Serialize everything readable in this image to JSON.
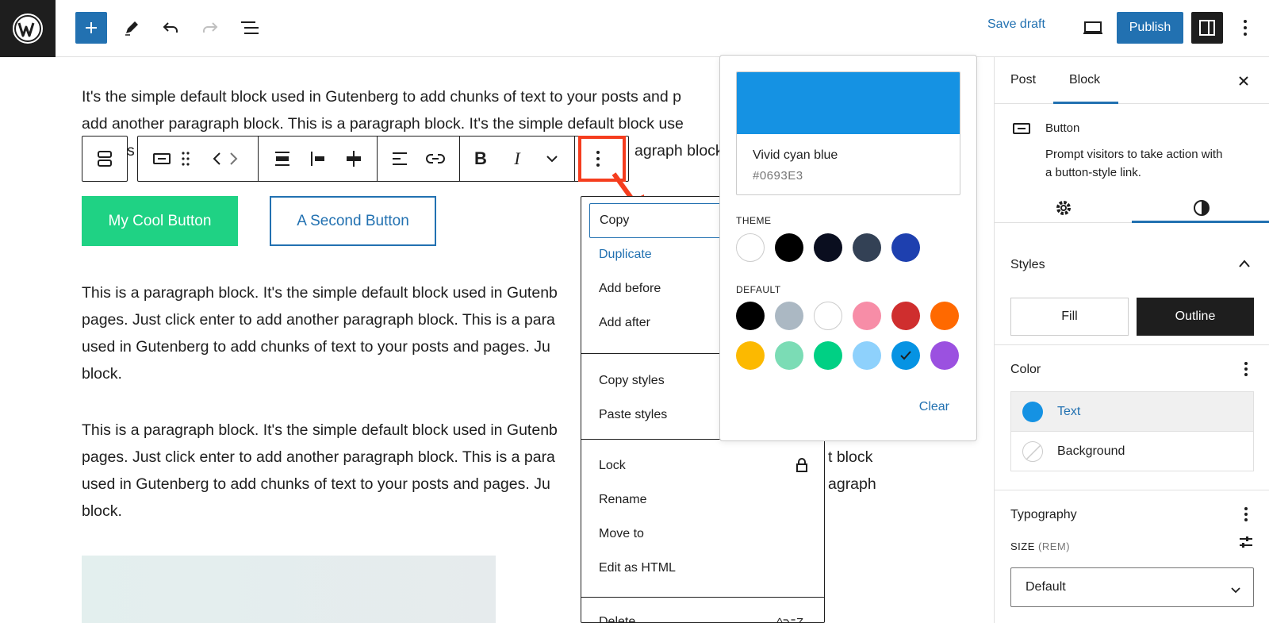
{
  "header": {
    "save_draft": "Save draft",
    "publish": "Publish"
  },
  "content": {
    "para1_line1": "It's the simple default block used in Gutenberg to add chunks of text to your posts and p",
    "para1_line2": "add another paragraph block. This is a paragraph block. It's the simple default block use",
    "para1_line3_fragment_a": "s",
    "para1_line3_fragment_b": "agraph block.",
    "button1_label": "My Cool Button",
    "button2_label": "A Second Button",
    "para2_lines": [
      "This is a paragraph block. It's the simple default block used in Gutenb",
      "pages. Just click enter to add another paragraph block. This is a para",
      "used in Gutenberg to add chunks of text to your posts and pages. Ju",
      "block."
    ],
    "para3_lines": [
      "This is a paragraph block. It's the simple default block used in Gutenb",
      "pages. Just click enter to add another paragraph block. This is a para",
      "used in Gutenberg to add chunks of text to your posts and pages. Ju",
      "block."
    ],
    "para3_right": {
      "line2": "t block",
      "line3": "agraph"
    }
  },
  "menu": {
    "items": [
      {
        "label": "Copy"
      },
      {
        "label": "Duplicate"
      },
      {
        "label": "Add before"
      },
      {
        "label": "Add after"
      },
      {
        "label": "Copy styles"
      },
      {
        "label": "Paste styles"
      },
      {
        "label": "Lock"
      },
      {
        "label": "Rename"
      },
      {
        "label": "Move to"
      },
      {
        "label": "Edit as HTML"
      },
      {
        "label": "Delete"
      }
    ],
    "delete_shortcut": "^⌥Z"
  },
  "color_picker": {
    "selected_name": "Vivid cyan blue",
    "selected_hex": "#0693E3",
    "theme_title": "THEME",
    "default_title": "DEFAULT",
    "clear": "Clear",
    "theme_colors": [
      "#ffffff",
      "#000000",
      "#0a0e1f",
      "#334155",
      "#1e40af"
    ],
    "default_colors_row1": [
      "#000000",
      "#abb8c3",
      "#ffffff",
      "#f78da7",
      "#cf2e2e",
      "#ff6900"
    ],
    "default_colors_row2": [
      "#fcb900",
      "#7bdcb5",
      "#00d084",
      "#8ed1fc",
      "#0693e3",
      "#9b51e0"
    ]
  },
  "sidebar": {
    "tab_post": "Post",
    "tab_block": "Block",
    "block_name": "Button",
    "block_desc_line1": "Prompt visitors to take action with",
    "block_desc_line2": "a button-style link.",
    "styles_title": "Styles",
    "style_fill": "Fill",
    "style_outline": "Outline",
    "color_title": "Color",
    "color_text": "Text",
    "color_background": "Background",
    "text_color": "#0693e3",
    "typography_title": "Typography",
    "size_label": "SIZE",
    "size_unit": "(REM)",
    "size_value": "Default"
  },
  "accent": "#2271b1",
  "highlight_color": "#f53d1e"
}
